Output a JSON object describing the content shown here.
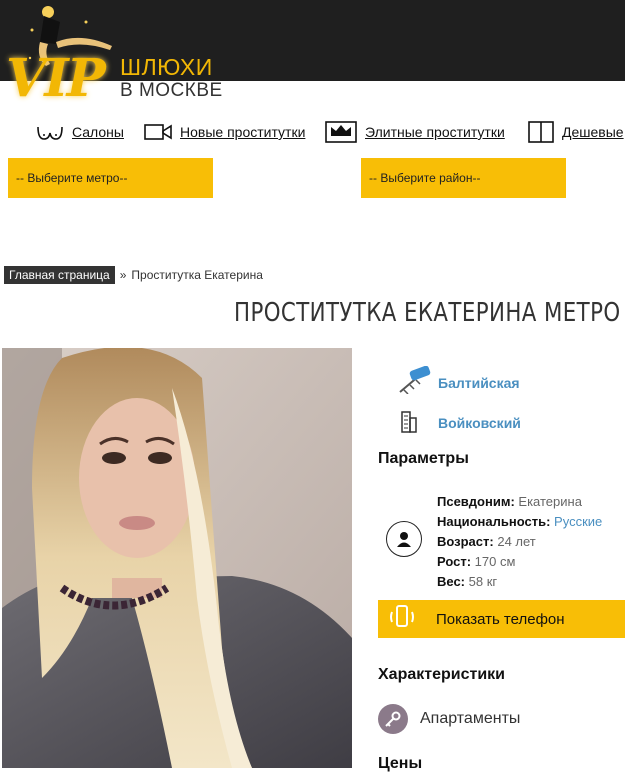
{
  "logo": {
    "vip": "VIP",
    "line1": "ШЛЮХИ",
    "line2": "В МОСКВЕ"
  },
  "nav": [
    {
      "label": "Салоны",
      "icon": "bust-icon"
    },
    {
      "label": "Новые проститутки",
      "icon": "video-camera-icon"
    },
    {
      "label": "Элитные проститутки",
      "icon": "crown-icon"
    },
    {
      "label": "Дешевые",
      "icon": "book-icon"
    }
  ],
  "filters": {
    "metro_label": "-- Выберите метро--",
    "district_label": "-- Выберите район--"
  },
  "breadcrumb": {
    "home": "Главная страница",
    "separator": "»",
    "current": "Проститутка Екатерина"
  },
  "title": "ПРОСТИТУТКА ЕКАТЕРИНА МЕТРО I",
  "location": {
    "metro": "Балтийская",
    "district": "Войковский"
  },
  "params": {
    "heading": "Параметры",
    "nickname_key": "Псевдоним:",
    "nickname": "Екатерина",
    "nationality_key": "Национальность:",
    "nationality": "Русские",
    "age_key": "Возраст:",
    "age": "24 лет",
    "height_key": "Рост:",
    "height": "170 см",
    "weight_key": "Вес:",
    "weight": "58 кг"
  },
  "phone_button": "Показать телефон",
  "features": {
    "heading": "Характеристики",
    "item": "Апартаменты"
  },
  "prices": {
    "heading": "Цены"
  },
  "colors": {
    "accent": "#f8be06",
    "header": "#1f1f1f",
    "link": "#4a8fc0"
  }
}
